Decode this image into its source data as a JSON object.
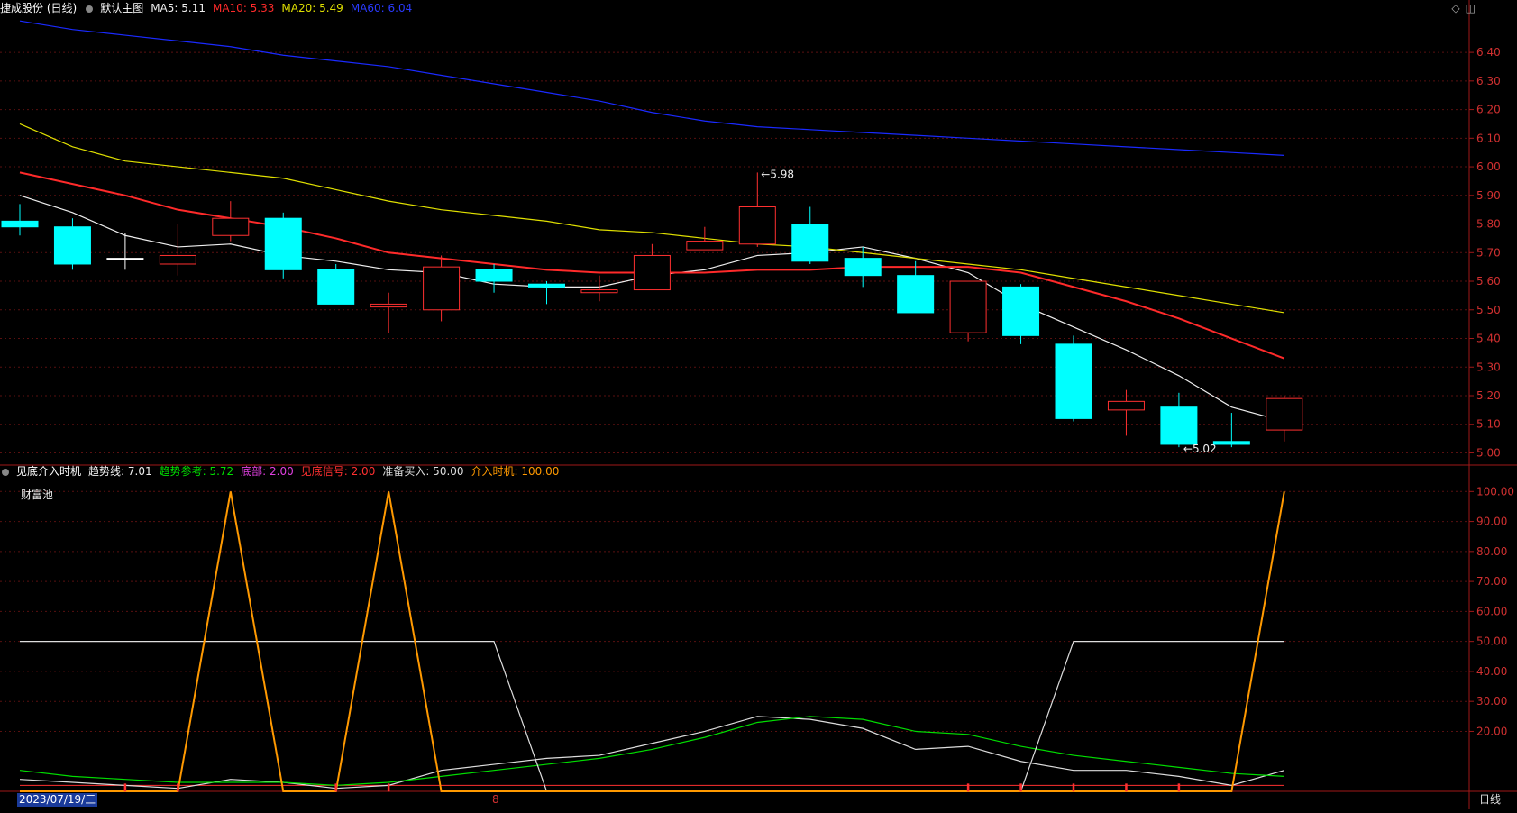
{
  "header": {
    "stock": "捷成股份 (日线)",
    "main_label": "默认主图",
    "ma5": "MA5: 5.11",
    "ma10": "MA10: 5.33",
    "ma20": "MA20: 5.49",
    "ma60": "MA60: 6.04",
    "ma_colors": {
      "ma5": "#eeeeee",
      "ma10": "#ff2a2a",
      "ma20": "#e0e000",
      "ma60": "#1a2aff"
    }
  },
  "sub_header": {
    "name": "见底介入时机",
    "trend": "趋势线: 7.01",
    "trend_ref": "趋势参考: 5.72",
    "bottom": "底部: 2.00",
    "bottom_signal": "见底信号: 2.00",
    "ready": "准备买入: 50.00",
    "entry": "介入时机: 100.00",
    "colors": {
      "trend": "#eeeeee",
      "trend_ref": "#00e000",
      "bottom": "#e040e0",
      "bottom_signal": "#ff3030",
      "ready": "#dddddd",
      "entry": "#ff9900"
    },
    "pool_label": "财富池"
  },
  "footer": {
    "date": "2023/07/19/三",
    "mark": "8",
    "period": "日线"
  },
  "chart_data": [
    {
      "type": "candlestick",
      "ylim": [
        4.97,
        6.52
      ],
      "yticks": [
        "6.40",
        "6.30",
        "6.20",
        "6.10",
        "6.00",
        "5.90",
        "5.80",
        "5.70",
        "5.60",
        "5.50",
        "5.40",
        "5.30",
        "5.20",
        "5.10",
        "5.00"
      ],
      "candles": [
        {
          "o": 5.81,
          "h": 5.87,
          "l": 5.76,
          "c": 5.79
        },
        {
          "o": 5.79,
          "h": 5.82,
          "l": 5.64,
          "c": 5.66
        },
        {
          "o": 5.68,
          "h": 5.77,
          "l": 5.64,
          "c": 5.68
        },
        {
          "o": 5.66,
          "h": 5.8,
          "l": 5.62,
          "c": 5.69
        },
        {
          "o": 5.76,
          "h": 5.88,
          "l": 5.74,
          "c": 5.82
        },
        {
          "o": 5.82,
          "h": 5.84,
          "l": 5.61,
          "c": 5.64
        },
        {
          "o": 5.64,
          "h": 5.66,
          "l": 5.52,
          "c": 5.52
        },
        {
          "o": 5.51,
          "h": 5.56,
          "l": 5.42,
          "c": 5.52
        },
        {
          "o": 5.5,
          "h": 5.69,
          "l": 5.46,
          "c": 5.65
        },
        {
          "o": 5.64,
          "h": 5.66,
          "l": 5.56,
          "c": 5.6
        },
        {
          "o": 5.59,
          "h": 5.6,
          "l": 5.52,
          "c": 5.58
        },
        {
          "o": 5.56,
          "h": 5.62,
          "l": 5.53,
          "c": 5.57
        },
        {
          "o": 5.57,
          "h": 5.73,
          "l": 5.57,
          "c": 5.69
        },
        {
          "o": 5.71,
          "h": 5.79,
          "l": 5.71,
          "c": 5.74
        },
        {
          "o": 5.73,
          "h": 5.98,
          "l": 5.72,
          "c": 5.86
        },
        {
          "o": 5.8,
          "h": 5.86,
          "l": 5.66,
          "c": 5.67
        },
        {
          "o": 5.68,
          "h": 5.72,
          "l": 5.58,
          "c": 5.62
        },
        {
          "o": 5.62,
          "h": 5.67,
          "l": 5.49,
          "c": 5.49
        },
        {
          "o": 5.42,
          "h": 5.6,
          "l": 5.39,
          "c": 5.6
        },
        {
          "o": 5.58,
          "h": 5.59,
          "l": 5.38,
          "c": 5.41
        },
        {
          "o": 5.38,
          "h": 5.41,
          "l": 5.11,
          "c": 5.12
        },
        {
          "o": 5.15,
          "h": 5.22,
          "l": 5.06,
          "c": 5.18
        },
        {
          "o": 5.16,
          "h": 5.21,
          "l": 5.02,
          "c": 5.03
        },
        {
          "o": 5.04,
          "h": 5.14,
          "l": 5.02,
          "c": 5.03
        },
        {
          "o": 5.08,
          "h": 5.2,
          "l": 5.04,
          "c": 5.19
        }
      ],
      "series": [
        {
          "name": "MA5",
          "color": "#eeeeee",
          "values": [
            5.9,
            5.84,
            5.76,
            5.72,
            5.73,
            5.69,
            5.67,
            5.64,
            5.63,
            5.59,
            5.58,
            5.58,
            5.62,
            5.64,
            5.69,
            5.7,
            5.72,
            5.68,
            5.63,
            5.52,
            5.44,
            5.36,
            5.27,
            5.16,
            5.11
          ]
        },
        {
          "name": "MA10",
          "color": "#ff2a2a",
          "values": [
            5.98,
            5.94,
            5.9,
            5.85,
            5.82,
            5.79,
            5.75,
            5.7,
            5.68,
            5.66,
            5.64,
            5.63,
            5.63,
            5.63,
            5.64,
            5.64,
            5.65,
            5.65,
            5.65,
            5.63,
            5.58,
            5.53,
            5.47,
            5.4,
            5.33
          ]
        },
        {
          "name": "MA20",
          "color": "#e0e000",
          "values": [
            6.15,
            6.07,
            6.02,
            6.0,
            5.98,
            5.96,
            5.92,
            5.88,
            5.85,
            5.83,
            5.81,
            5.78,
            5.77,
            5.75,
            5.73,
            5.72,
            5.7,
            5.68,
            5.66,
            5.64,
            5.61,
            5.58,
            5.55,
            5.52,
            5.49
          ]
        },
        {
          "name": "MA60",
          "color": "#1a2aff",
          "values": [
            6.51,
            6.48,
            6.46,
            6.44,
            6.42,
            6.39,
            6.37,
            6.35,
            6.32,
            6.29,
            6.26,
            6.23,
            6.19,
            6.16,
            6.14,
            6.13,
            6.12,
            6.11,
            6.1,
            6.09,
            6.08,
            6.07,
            6.06,
            6.05,
            6.04
          ]
        }
      ],
      "annotations": [
        {
          "index": 14,
          "value": 5.98,
          "text": "5.98"
        },
        {
          "index": 22,
          "value": 5.02,
          "text": "5.02"
        }
      ]
    },
    {
      "type": "line",
      "ylim": [
        0,
        104
      ],
      "yticks": [
        "100.00",
        "90.00",
        "80.00",
        "70.00",
        "60.00",
        "50.00",
        "40.00",
        "30.00",
        "20.00"
      ],
      "series": [
        {
          "name": "趋势线",
          "color": "#dddddd",
          "values": [
            4,
            3,
            2,
            1,
            4,
            3,
            1,
            2,
            7,
            9,
            11,
            12,
            16,
            20,
            25,
            24,
            21,
            14,
            15,
            10,
            7,
            7,
            5,
            2,
            7
          ]
        },
        {
          "name": "趋势参考",
          "color": "#00dd00",
          "values": [
            7,
            5,
            4,
            3,
            3,
            3,
            2,
            3,
            5,
            7,
            9,
            11,
            14,
            18,
            23,
            25,
            24,
            20,
            19,
            15,
            12,
            10,
            8,
            6,
            5
          ]
        },
        {
          "name": "准备买入",
          "color": "#dddddd",
          "values": [
            50,
            50,
            50,
            50,
            50,
            50,
            50,
            50,
            50,
            50,
            0,
            0,
            0,
            0,
            0,
            0,
            0,
            0,
            0,
            0,
            50,
            50,
            50,
            50,
            50
          ]
        },
        {
          "name": "介入时机",
          "color": "#ff9900",
          "values": [
            0,
            0,
            0,
            0,
            100,
            0,
            0,
            100,
            0,
            0,
            0,
            0,
            0,
            0,
            0,
            0,
            0,
            0,
            0,
            0,
            0,
            0,
            0,
            0,
            100
          ]
        }
      ],
      "baseline": {
        "name": "底部",
        "value": 2,
        "color": "#ff3030"
      },
      "signals": [
        2,
        3,
        6,
        7,
        18,
        19,
        20,
        21,
        22
      ]
    }
  ]
}
